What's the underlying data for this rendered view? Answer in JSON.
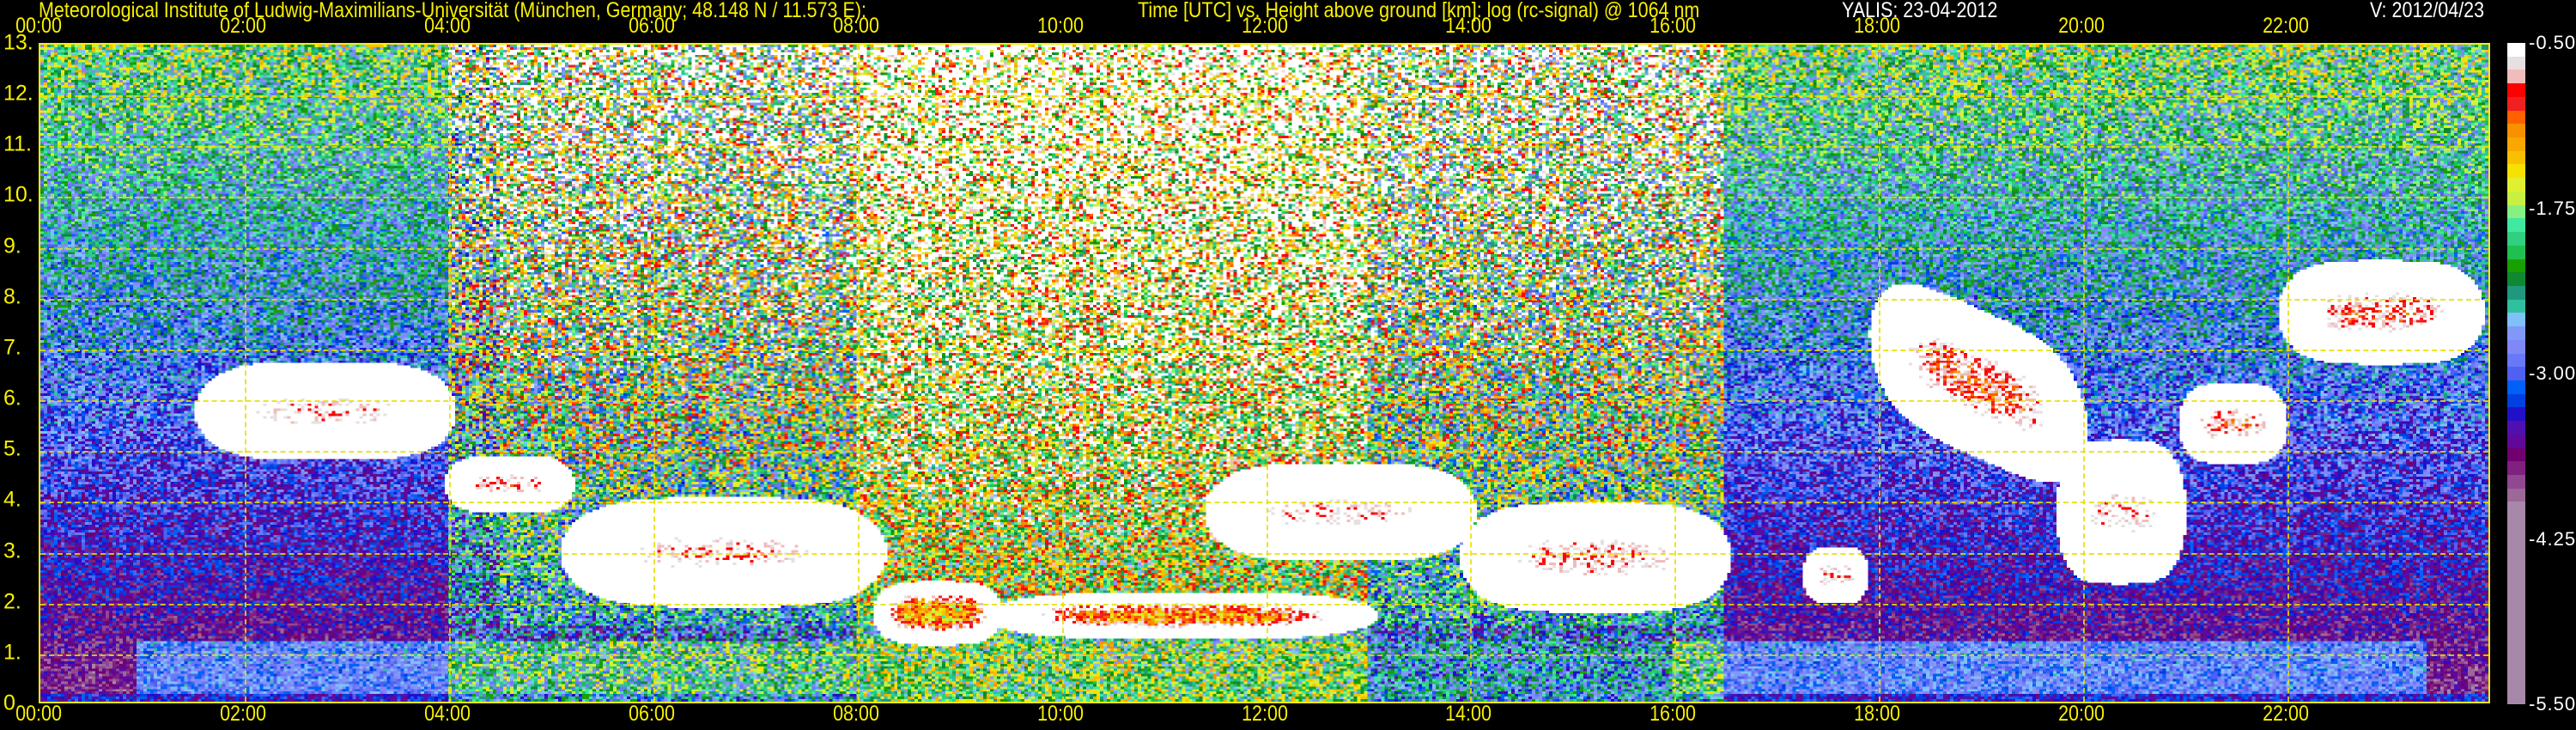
{
  "header": {
    "institute": "Meteorological Institute of Ludwig-Maximilians-Universität (München, Germany; 48.148 N / 11.573 E):",
    "plot_desc": "Time [UTC] vs. Height above ground [km]: log (rc-signal) @ 1064 nm",
    "instrument": "YALIS: 23-04-2012",
    "version": "V: 2012/04/23"
  },
  "chart_data": {
    "type": "heatmap",
    "title": "Time [UTC] vs. Height above ground [km]: log (rc-signal) @ 1064 nm",
    "xlabel": "Time [UTC]",
    "ylabel": "Height above ground [km]",
    "xlim": [
      0,
      24
    ],
    "ylim": [
      0,
      13
    ],
    "x_ticks": [
      "00:00",
      "02:00",
      "04:00",
      "06:00",
      "08:00",
      "10:00",
      "12:00",
      "14:00",
      "16:00",
      "18:00",
      "20:00",
      "22:00"
    ],
    "y_ticks": [
      "0",
      "1.",
      "2.",
      "3.",
      "4.",
      "5.",
      "6.",
      "7.",
      "8.",
      "9.",
      "10.",
      "11.",
      "12.",
      "13."
    ],
    "grid": true,
    "colorbar": {
      "range": [
        -5.5,
        -0.5
      ],
      "labels": [
        "-0.50",
        "-1.75",
        "-3.00",
        "-4.25",
        "-5.50"
      ],
      "colors": [
        "#ffffff",
        "#e8dfe0",
        "#f0bcbc",
        "#ff0000",
        "#f02020",
        "#ff6000",
        "#f89000",
        "#f8a800",
        "#f8c000",
        "#f8e000",
        "#e0f030",
        "#c8f040",
        "#88f080",
        "#40e8a0",
        "#30d080",
        "#20c050",
        "#18a000",
        "#108830",
        "#209880",
        "#30c0a0",
        "#80c0f8",
        "#8098f8",
        "#8088f8",
        "#6878f8",
        "#5060f0",
        "#0060f8",
        "#0040e0",
        "#2010c8",
        "#5010b0",
        "#600898",
        "#700070",
        "#802080",
        "#904890",
        "#9c6898",
        "#a888a8"
      ]
    },
    "cloud_layers": [
      {
        "t": [
          1.6,
          4.0
        ],
        "z": [
          4.9,
          6.6
        ],
        "peak": -0.5
      },
      {
        "t": [
          4.0,
          5.2
        ],
        "z": [
          3.8,
          4.8
        ],
        "peak": -0.6
      },
      {
        "t": [
          5.2,
          8.2
        ],
        "z": [
          2.0,
          3.9
        ],
        "peak": -0.5
      },
      {
        "t": [
          8.2,
          9.4
        ],
        "z": [
          1.2,
          2.3
        ],
        "peak": -1.4
      },
      {
        "t": [
          9.4,
          13.0
        ],
        "z": [
          1.3,
          2.1
        ],
        "peak": -1.2
      },
      {
        "t": [
          11.5,
          14.0
        ],
        "z": [
          2.9,
          4.6
        ],
        "peak": -0.5
      },
      {
        "t": [
          14.0,
          16.5
        ],
        "z": [
          1.9,
          3.8
        ],
        "peak": -0.6
      },
      {
        "t": [
          17.3,
          17.9
        ],
        "z": [
          2.0,
          3.0
        ],
        "peak": -0.6
      },
      {
        "t": [
          18.0,
          20.0
        ],
        "z": [
          5.0,
          7.6
        ],
        "peak": -0.8
      },
      {
        "t": [
          19.8,
          21.0
        ],
        "z": [
          2.5,
          5.0
        ],
        "peak": -0.5
      },
      {
        "t": [
          21.0,
          22.0
        ],
        "z": [
          4.8,
          6.2
        ],
        "peak": -0.7
      },
      {
        "t": [
          22.0,
          23.9
        ],
        "z": [
          6.8,
          8.6
        ],
        "peak": -0.7
      }
    ],
    "boundary_layer_top_km": 1.2,
    "solar_noise_period": [
      4.0,
      16.5
    ]
  }
}
